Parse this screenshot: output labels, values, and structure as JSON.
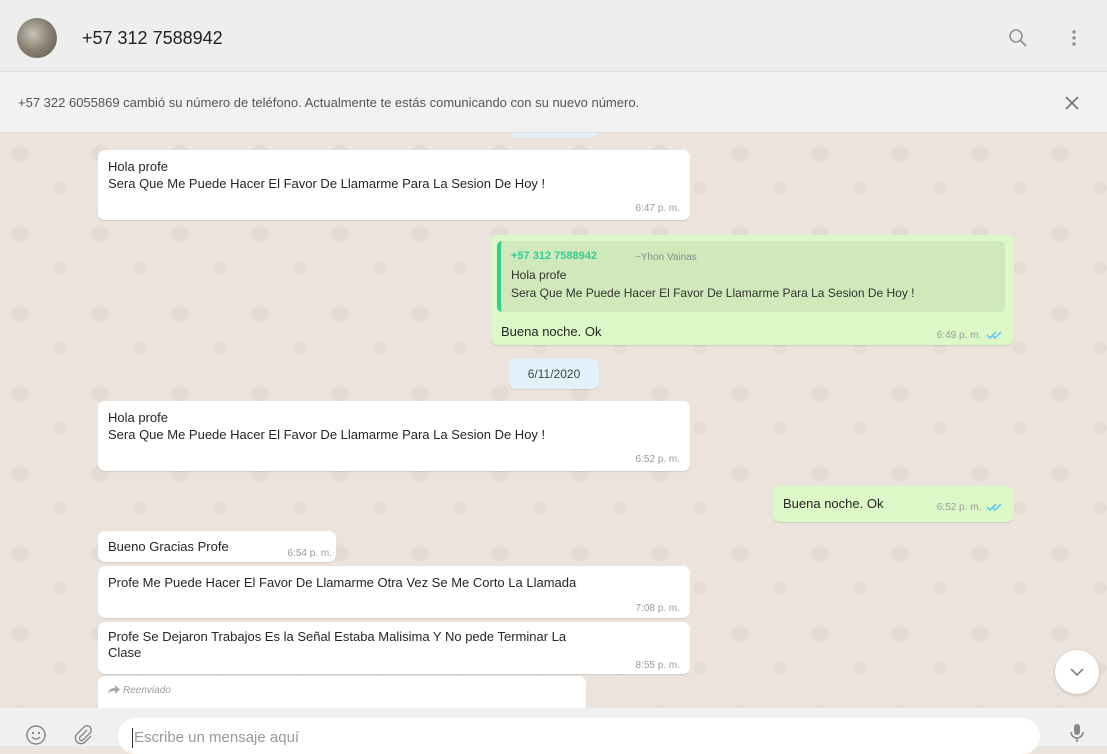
{
  "header": {
    "contact_name": "+57 312 7588942"
  },
  "banner": {
    "text": "+57 322 6055869 cambió su número de teléfono. Actualmente te estás comunicando con su nuevo número."
  },
  "messages": [
    {
      "dir": "in",
      "lines": [
        "Hola profe",
        "Sera Que Me Puede Hacer El Favor De Llamarme Para La Sesion De Hoy !"
      ],
      "time": "6:47 p. m."
    },
    {
      "dir": "out",
      "quote_sender": "+57 312 7588942",
      "quote_name": "~Yhon Vainas",
      "quote_lines": [
        "Hola profe",
        "Sera Que Me Puede Hacer El Favor De Llamarme Para La Sesion De Hoy !"
      ],
      "text": "Buena noche. Ok",
      "time": "6:49 p. m."
    },
    {
      "dir": "in",
      "lines": [
        "Hola profe",
        "Sera Que Me Puede Hacer El Favor De Llamarme Para La Sesion De Hoy !"
      ],
      "time": "6:52 p. m."
    },
    {
      "dir": "out",
      "text": "Buena noche. Ok",
      "time": "6:52 p. m."
    },
    {
      "dir": "in",
      "text": "Bueno Gracias Profe",
      "time": "6:54 p. m."
    },
    {
      "dir": "in",
      "text": "Profe Me Puede Hacer El Favor De Llamarme Otra Vez Se Me Corto La Llamada",
      "time": "7:08 p. m."
    },
    {
      "dir": "in",
      "lines": [
        "Profe Se Dejaron Trabajos Es la Señal Estaba Malisima  Y No pede Terminar La",
        "Clase"
      ],
      "time": "8:55 p. m."
    },
    {
      "dir": "in",
      "forwarded_label": "Reenviado"
    }
  ],
  "date_separator": "6/11/2020",
  "composer": {
    "placeholder": "Escribe un mensaje aquí"
  },
  "colors": {
    "outgoing_bubble": "#dcf8c6",
    "incoming_bubble": "#ffffff",
    "read_ticks": "#4fc3f7",
    "quote_accent": "#35cd96",
    "date_chip": "#e1f2fb"
  }
}
